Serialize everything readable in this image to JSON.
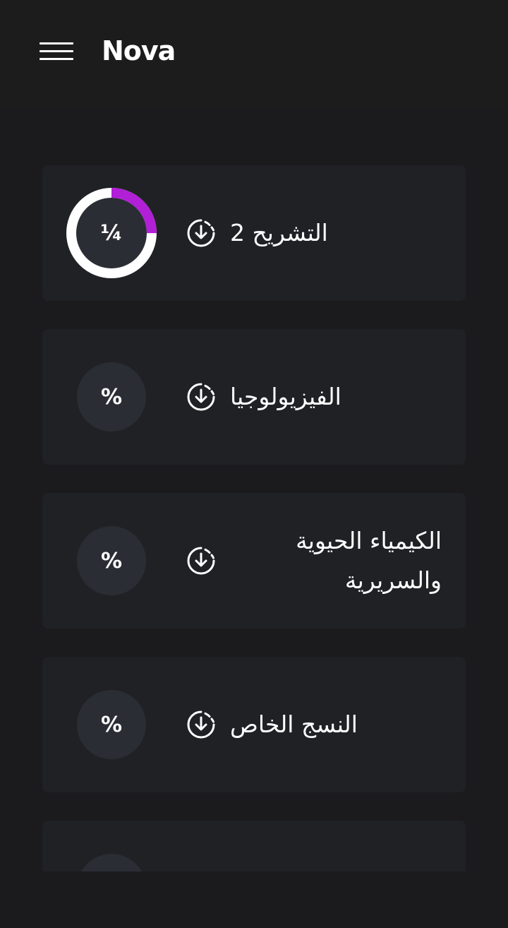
{
  "app_bar": {
    "title": "Nova",
    "menu_icon": "hamburger-menu-icon"
  },
  "courses": [
    {
      "title": "التشريح 2",
      "progress_label": "¼",
      "progress": 0.25,
      "progress_color": "#b11fd6",
      "download_icon": "download-circle-icon"
    },
    {
      "title": "الفيزيولوجيا",
      "progress_label": "%",
      "download_icon": "download-circle-icon"
    },
    {
      "title": "الكيمياء الحيوية والسريرية",
      "progress_label": "%",
      "download_icon": "download-circle-icon"
    },
    {
      "title": "النسج الخاص",
      "progress_label": "%",
      "download_icon": "download-circle-icon"
    },
    {
      "title": "",
      "progress_label": "",
      "download_icon": "download-circle-icon"
    }
  ],
  "colors": {
    "background": "#1b1b1e",
    "app_bar": "#1c1c1c",
    "card": "#202125",
    "circle": "#2a2d34",
    "accent": "#b11fd6"
  }
}
